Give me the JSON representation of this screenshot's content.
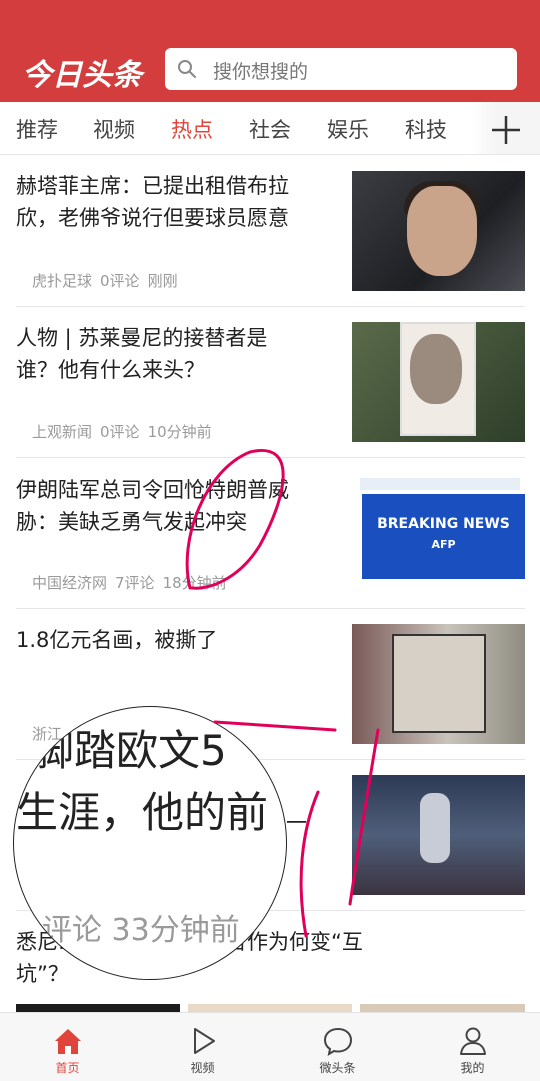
{
  "header": {
    "logo": "今日头条",
    "search_placeholder": "搜你想搜的"
  },
  "tabs": [
    {
      "label": "推荐",
      "active": false
    },
    {
      "label": "视频",
      "active": false
    },
    {
      "label": "热点",
      "active": true
    },
    {
      "label": "社会",
      "active": false
    },
    {
      "label": "娱乐",
      "active": false
    },
    {
      "label": "科技",
      "active": false
    }
  ],
  "articles": [
    {
      "title_lines": [
        "赫塔菲主席：已提出租借布拉",
        "欣，老佛爷说行但要球员愿意"
      ],
      "source": "虎扑足球",
      "comments": "0评论",
      "time": "刚刚"
    },
    {
      "title_lines": [
        "人物 | 苏莱曼尼的接替者是",
        "谁？他有什么来头？"
      ],
      "source": "上观新闻",
      "comments": "0评论",
      "time": "10分钟前"
    },
    {
      "title_lines": [
        "伊朗陆军总司令回怆特朗普威",
        "胁：美缺乏勇气发起冲突"
      ],
      "source": "中国经济网",
      "comments": "7评论",
      "time": "18分钟前"
    },
    {
      "title_lines": [
        "1.8亿元名画，被撕了"
      ],
      "source": "浙江"
    },
    {
      "title_lines": [
        "",
        "一"
      ]
    },
    {
      "title_lines": [
        "悉尼…………阁，公私合作为何变“互",
        "坑”？"
      ]
    }
  ],
  "thumb_text": {
    "breaking": "BREAKING NEWS",
    "agency": "AFP"
  },
  "magnifier": {
    "line1": "脚踏欧文5",
    "line2": "生涯，他的前",
    "line3": "评论  33分钟前"
  },
  "bottom_nav": [
    {
      "label": "首页",
      "icon": "home-icon",
      "active": true
    },
    {
      "label": "视频",
      "icon": "play-icon",
      "active": false
    },
    {
      "label": "微头条",
      "icon": "chat-bubble-icon",
      "active": false
    },
    {
      "label": "我的",
      "icon": "person-icon",
      "active": false
    }
  ],
  "colors": {
    "brand_red": "#d43d3d",
    "active_tab": "#e0443b",
    "annotation": "#e0005a"
  }
}
